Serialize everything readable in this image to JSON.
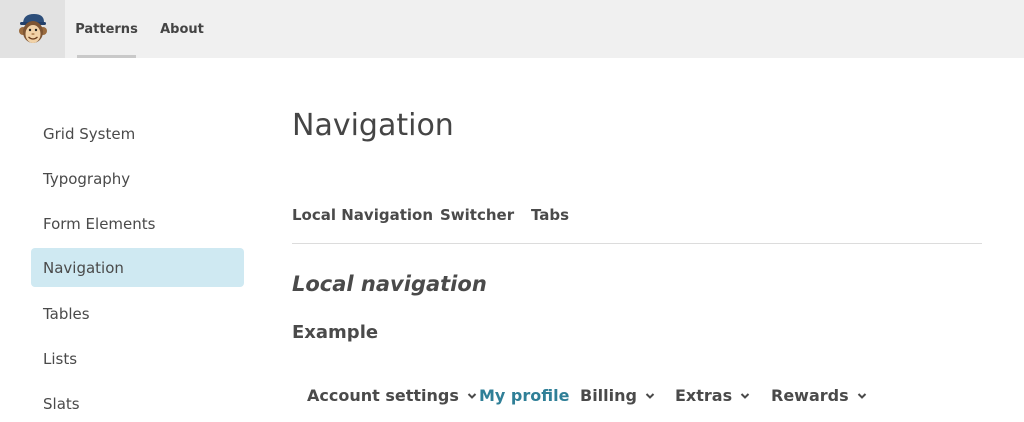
{
  "header": {
    "logo_name": "freddie-monkey-logo",
    "nav": [
      {
        "label": "Patterns",
        "active": true
      },
      {
        "label": "About",
        "active": false
      }
    ]
  },
  "sidebar": {
    "items": [
      {
        "label": "Grid System"
      },
      {
        "label": "Typography"
      },
      {
        "label": "Form Elements"
      },
      {
        "label": "Navigation",
        "active": true
      },
      {
        "label": "Tables"
      },
      {
        "label": "Lists"
      },
      {
        "label": "Slats"
      }
    ]
  },
  "main": {
    "title": "Navigation",
    "subnav": [
      {
        "label": "Local Navigation"
      },
      {
        "label": "Switcher"
      },
      {
        "label": "Tabs"
      }
    ],
    "section_title": "Local navigation",
    "example_label": "Example",
    "demo_nav": [
      {
        "label": "Account settings",
        "dropdown": true
      },
      {
        "label": "My profile",
        "dropdown": false,
        "current": true
      },
      {
        "label": "Billing",
        "dropdown": true
      },
      {
        "label": "Extras",
        "dropdown": true
      },
      {
        "label": "Rewards",
        "dropdown": true
      }
    ]
  },
  "colors": {
    "topbar_bg": "#f0f0f0",
    "active_sidebar_bg": "#cfe9f2",
    "current_link": "#2f7f97"
  }
}
